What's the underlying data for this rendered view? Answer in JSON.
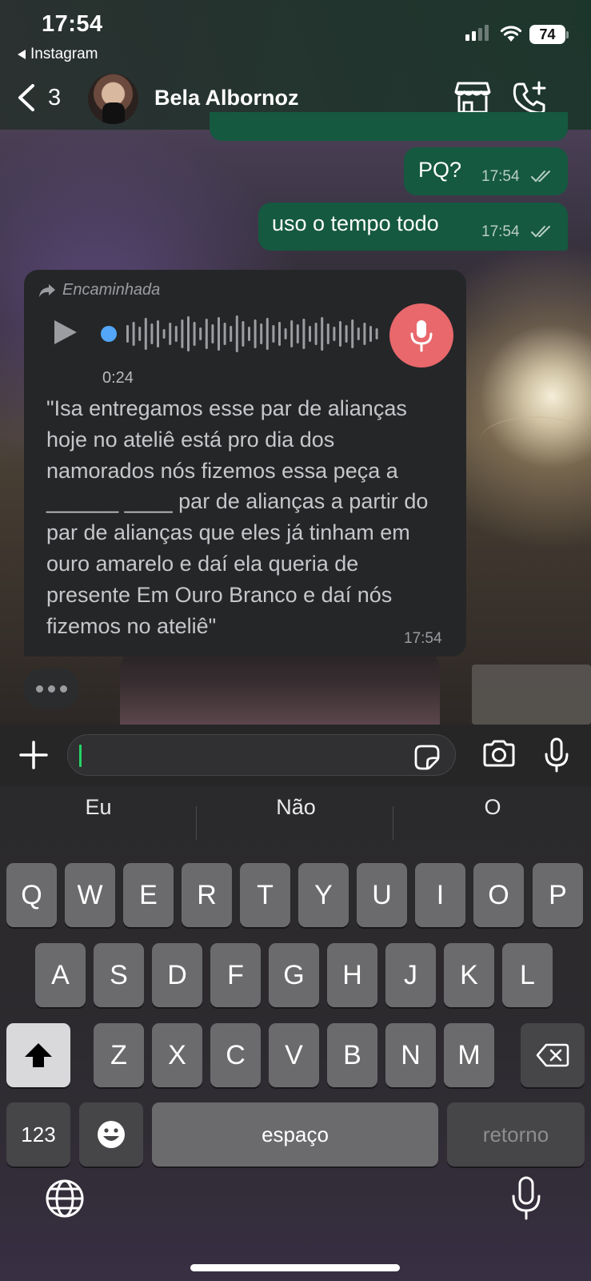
{
  "status_bar": {
    "time": "17:54",
    "back_app": "Instagram",
    "battery": "74"
  },
  "header": {
    "back_count": "3",
    "contact_name": "Bela Albornoz"
  },
  "messages": {
    "outgoing_1": {
      "text": "PQ?",
      "time": "17:54"
    },
    "outgoing_2": {
      "text": "uso o tempo todo",
      "time": "17:54"
    },
    "incoming_voice": {
      "forwarded_label": "Encaminhada",
      "duration": "0:24",
      "transcript": "\"Isa entregamos esse par de alianças hoje no ateliê está pro dia dos namorados nós fizemos essa peça a ______ ____ par de alianças a partir do par de alianças que eles já tinham em ouro amarelo e daí ela queria de presente Em Ouro Branco e daí nós fizemos no ateliê\"",
      "time": "17:54"
    }
  },
  "composer": {
    "input_value": "",
    "input_placeholder": ""
  },
  "keyboard": {
    "suggestions": [
      "Eu",
      "Não",
      "O"
    ],
    "row1": [
      "Q",
      "W",
      "E",
      "R",
      "T",
      "Y",
      "U",
      "I",
      "O",
      "P"
    ],
    "row2": [
      "A",
      "S",
      "D",
      "F",
      "G",
      "H",
      "J",
      "K",
      "L"
    ],
    "row3": [
      "Z",
      "X",
      "C",
      "V",
      "B",
      "N",
      "M"
    ],
    "numbers_key": "123",
    "space_key": "espaço",
    "return_key": "retorno"
  },
  "icons": {
    "back": "chevron-left-icon",
    "shop": "store-icon",
    "call": "add-call-icon",
    "forward": "forward-arrow-icon",
    "play": "play-icon",
    "mic": "microphone-icon",
    "plus": "plus-icon",
    "sticker": "sticker-icon",
    "camera": "camera-icon",
    "shift": "shift-icon",
    "delete": "backspace-icon",
    "emoji": "emoji-icon",
    "globe": "globe-icon",
    "dictation": "microphone-icon"
  },
  "colors": {
    "outgoing_bubble": "#155940",
    "incoming_bubble": "#252628",
    "voice_mic": "#e8686c",
    "voice_dot": "#53a6f8",
    "caret": "#25d366"
  }
}
